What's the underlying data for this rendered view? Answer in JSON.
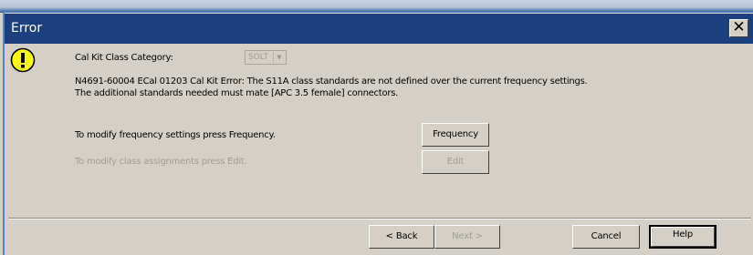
{
  "window": {
    "title": "Error",
    "close_glyph": "✕",
    "icon": "warning-icon"
  },
  "category": {
    "label": "Cal Kit Class Category:",
    "value": "SOLT",
    "arrow_glyph": "▼"
  },
  "message": {
    "line1": "N4691-60004 ECal 01203 Cal Kit Error: The S11A class standards are not defined over the current frequency settings.",
    "line2": "The additional standards needed must mate [APC 3.5 female] connectors."
  },
  "actions": {
    "frequency_hint": "To modify frequency settings press Frequency.",
    "frequency_label": "Frequency",
    "edit_hint": "To modify class assignments press Edit.",
    "edit_label": "Edit"
  },
  "footer": {
    "back_label": "< Back",
    "next_label": "Next >",
    "cancel_label": "Cancel",
    "help_label": "Help"
  },
  "colors": {
    "titlebar": "#1c3f7e",
    "warning_fill": "#ffff00",
    "dialog_bg": "#d4d0c8",
    "disabled_text": "#a09d96"
  }
}
